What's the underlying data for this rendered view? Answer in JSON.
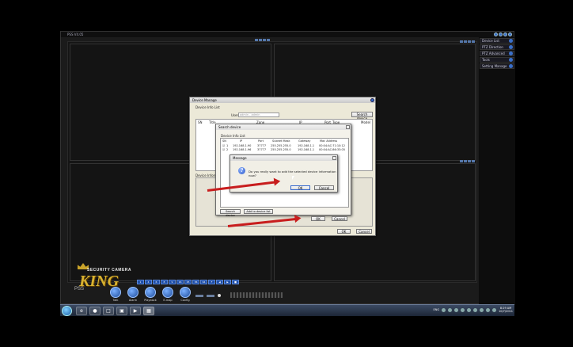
{
  "app": {
    "title": "PSS V4.05"
  },
  "side_panel": {
    "items": [
      {
        "label": "Device List"
      },
      {
        "label": "PTZ Direction"
      },
      {
        "label": "PTZ Advanced"
      },
      {
        "label": "Tools"
      },
      {
        "label": "Setting Manage"
      }
    ]
  },
  "toolbar": {
    "small_buttons": [
      "1",
      "4",
      "6",
      "8",
      "9",
      "16",
      "25",
      "36",
      "64",
      "F",
      "◀",
      "▶",
      "■"
    ],
    "big_buttons": [
      {
        "label": "Talk",
        "icon": "talk-icon"
      },
      {
        "label": "Alarm",
        "icon": "alarm-icon"
      },
      {
        "label": "Playback",
        "icon": "playback-icon"
      },
      {
        "label": "E-map",
        "icon": "emap-icon"
      },
      {
        "label": "Config",
        "icon": "config-icon"
      }
    ]
  },
  "logo": {
    "tag": "SECURITY CAMERA",
    "brand": "KING",
    "product": "PSS"
  },
  "device_manage": {
    "title": "Device Manage",
    "section": "Device Info List",
    "user_label": "User",
    "user_value": "admin - admin",
    "search_button": "Search device",
    "columns": [
      "SN",
      "Title",
      "Zone",
      "IP",
      "Port",
      "Type",
      "Model"
    ],
    "info_label": "Device Informatio",
    "ok": "OK",
    "cancel": "Cancel"
  },
  "search_device": {
    "title": "Search device",
    "section": "Device Info List",
    "columns": [
      "SN",
      "IP",
      "Port",
      "Subnet Mask",
      "Gateway",
      "Mac Address"
    ],
    "rows": [
      {
        "sn": "1",
        "ip": "192.168.1.90",
        "port": "37777",
        "mask": "255.255.255.0",
        "gw": "192.168.1.1",
        "mac": "00:04:AC:71:10:12"
      },
      {
        "sn": "2",
        "ip": "192.168.1.96",
        "port": "37777",
        "mask": "255.255.255.0",
        "gw": "192.168.1.1",
        "mac": "00:04:AC:86:33:05"
      }
    ],
    "search_button": "Search device",
    "add_button": "Add to device list",
    "ok": "OK",
    "cancel": "Cancel"
  },
  "message": {
    "title": "Message",
    "text": "Do you really want to add the selected device information now?",
    "ok": "OK",
    "cancel": "Cancel"
  },
  "taskbar": {
    "apps": [
      "e",
      "●",
      "□",
      "▣",
      "▶",
      "▦"
    ],
    "lang": "ENG",
    "time": "8:29 AM",
    "date": "10/7/2011"
  },
  "colors": {
    "accent": "#3a6fc8",
    "arrow": "#c81e1e",
    "dialog": "#ece9d8"
  }
}
